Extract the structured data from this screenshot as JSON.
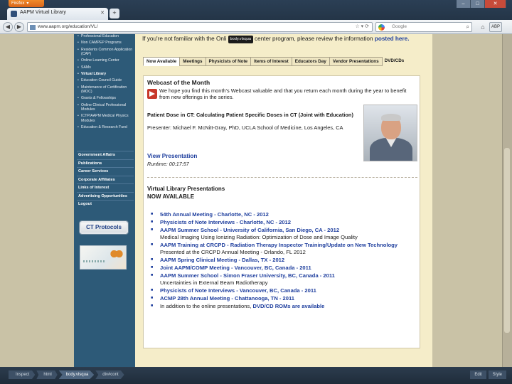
{
  "browser": {
    "app_button": "Firefox",
    "tab_title": "AAPM Virtual Library",
    "new_tab": "+",
    "url": "www.aapm.org/education/VL/",
    "search_placeholder": "Google",
    "addon_label": "ABP",
    "window_controls": [
      "–",
      "□",
      "✕"
    ]
  },
  "sidebar": {
    "items": [
      {
        "label": "Professional Education",
        "active": false
      },
      {
        "label": "Non CAMPEP Programs",
        "active": false
      },
      {
        "label": "Residents Common Application (CAP)",
        "active": false
      },
      {
        "label": "Online Learning Center",
        "active": false
      },
      {
        "label": "SAMs",
        "active": false
      },
      {
        "label": "Virtual Library",
        "active": true
      },
      {
        "label": "Education Council Guide",
        "active": false
      },
      {
        "label": "Maintenance of Certification (MOC)",
        "active": false
      },
      {
        "label": "Grants & Fellowships",
        "active": false
      },
      {
        "label": "Online Clinical Professional Modules",
        "active": false
      },
      {
        "label": "ICTP/AAPM Medical Physics Modules",
        "active": false
      },
      {
        "label": "Education & Research Fund",
        "active": false
      }
    ],
    "categories": [
      "Government Affairs",
      "Publications",
      "Career Services",
      "Corporate Affiliates",
      "Links of Interest",
      "Advertising Opportunities",
      "Logout"
    ],
    "ct_button": "CT Protocols"
  },
  "content": {
    "intro_before": "If you're not familiar with the Onli",
    "tooltip": "body.vlsqua",
    "intro_after": "center program, please review the information",
    "intro_link": "posted here.",
    "tabs": [
      {
        "label": "Now Available",
        "active": true
      },
      {
        "label": "Meetings",
        "active": false
      },
      {
        "label": "Physicists of Note",
        "active": false
      },
      {
        "label": "Items of Interest",
        "active": false
      },
      {
        "label": "Educators Day",
        "active": false
      },
      {
        "label": "Vendor Presentations",
        "active": false
      },
      {
        "label": "DVD/CDs",
        "active": false
      }
    ],
    "webcast": {
      "heading": "Webcast of the Month",
      "text": "We hope you find this month's Webcast valuable and that you return each month during the year to benefit from new offerings in the series.",
      "title": "Patient Dose in CT: Calculating Patient Specific Doses in CT (Joint with Education)",
      "presenter": "Presenter: Michael F. McNitt-Gray, PhD, UCLA School of Medicine, Los Angeles, CA",
      "view_link": "View Presentation",
      "runtime": "Runtime: 00:17:57"
    },
    "vl_heading_1": "Virtual Library Presentations",
    "vl_heading_2": "NOW AVAILABLE",
    "presentations": [
      {
        "link": "54th Annual Meeting - Charlotte, NC - 2012",
        "sub": ""
      },
      {
        "link": "Physicists of Note Interviews - Charlotte, NC - 2012",
        "sub": ""
      },
      {
        "link": "AAPM Summer School - University of California, San Diego, CA - 2012",
        "sub": "Medical Imaging Using Ionizing Radiation: Optimization of Dose and Image Quality"
      },
      {
        "link": "AAPM Training at CRCPD - Radiation Therapy Inspector Training/Update on New Technology",
        "sub": "Presented at the CRCPD Annual Meeting - Orlando, FL 2012"
      },
      {
        "link": "AAPM Spring Clinical Meeting - Dallas, TX - 2012",
        "sub": ""
      },
      {
        "link": "Joint AAPM/COMP Meeting - Vancouver, BC, Canada - 2011",
        "sub": ""
      },
      {
        "link": "AAPM Summer School - Simon Fraser University, BC, Canada - 2011",
        "sub": "Uncertainties in External Beam Radiotherapy"
      },
      {
        "link": "Physicists of Note Interviews - Vancouver, BC, Canada - 2011",
        "sub": ""
      },
      {
        "link": "ACMP 28th Annual Meeting - Chattanooga, TN - 2011",
        "sub": ""
      }
    ],
    "last_item_prefix": "In addition to the online presentations,",
    "last_item_link": "DVD/CD ROMs are available"
  },
  "addon_bar": {
    "crumbs": [
      "Inspect",
      "html",
      "body.vlsqua",
      "div#cont"
    ],
    "right": [
      "Edit",
      "Style"
    ]
  },
  "colors": {
    "sidebar": "#2d5a78",
    "content_bg": "#f5edc9",
    "link": "#1f3f9e",
    "page_bg": "#c9c2a6"
  }
}
